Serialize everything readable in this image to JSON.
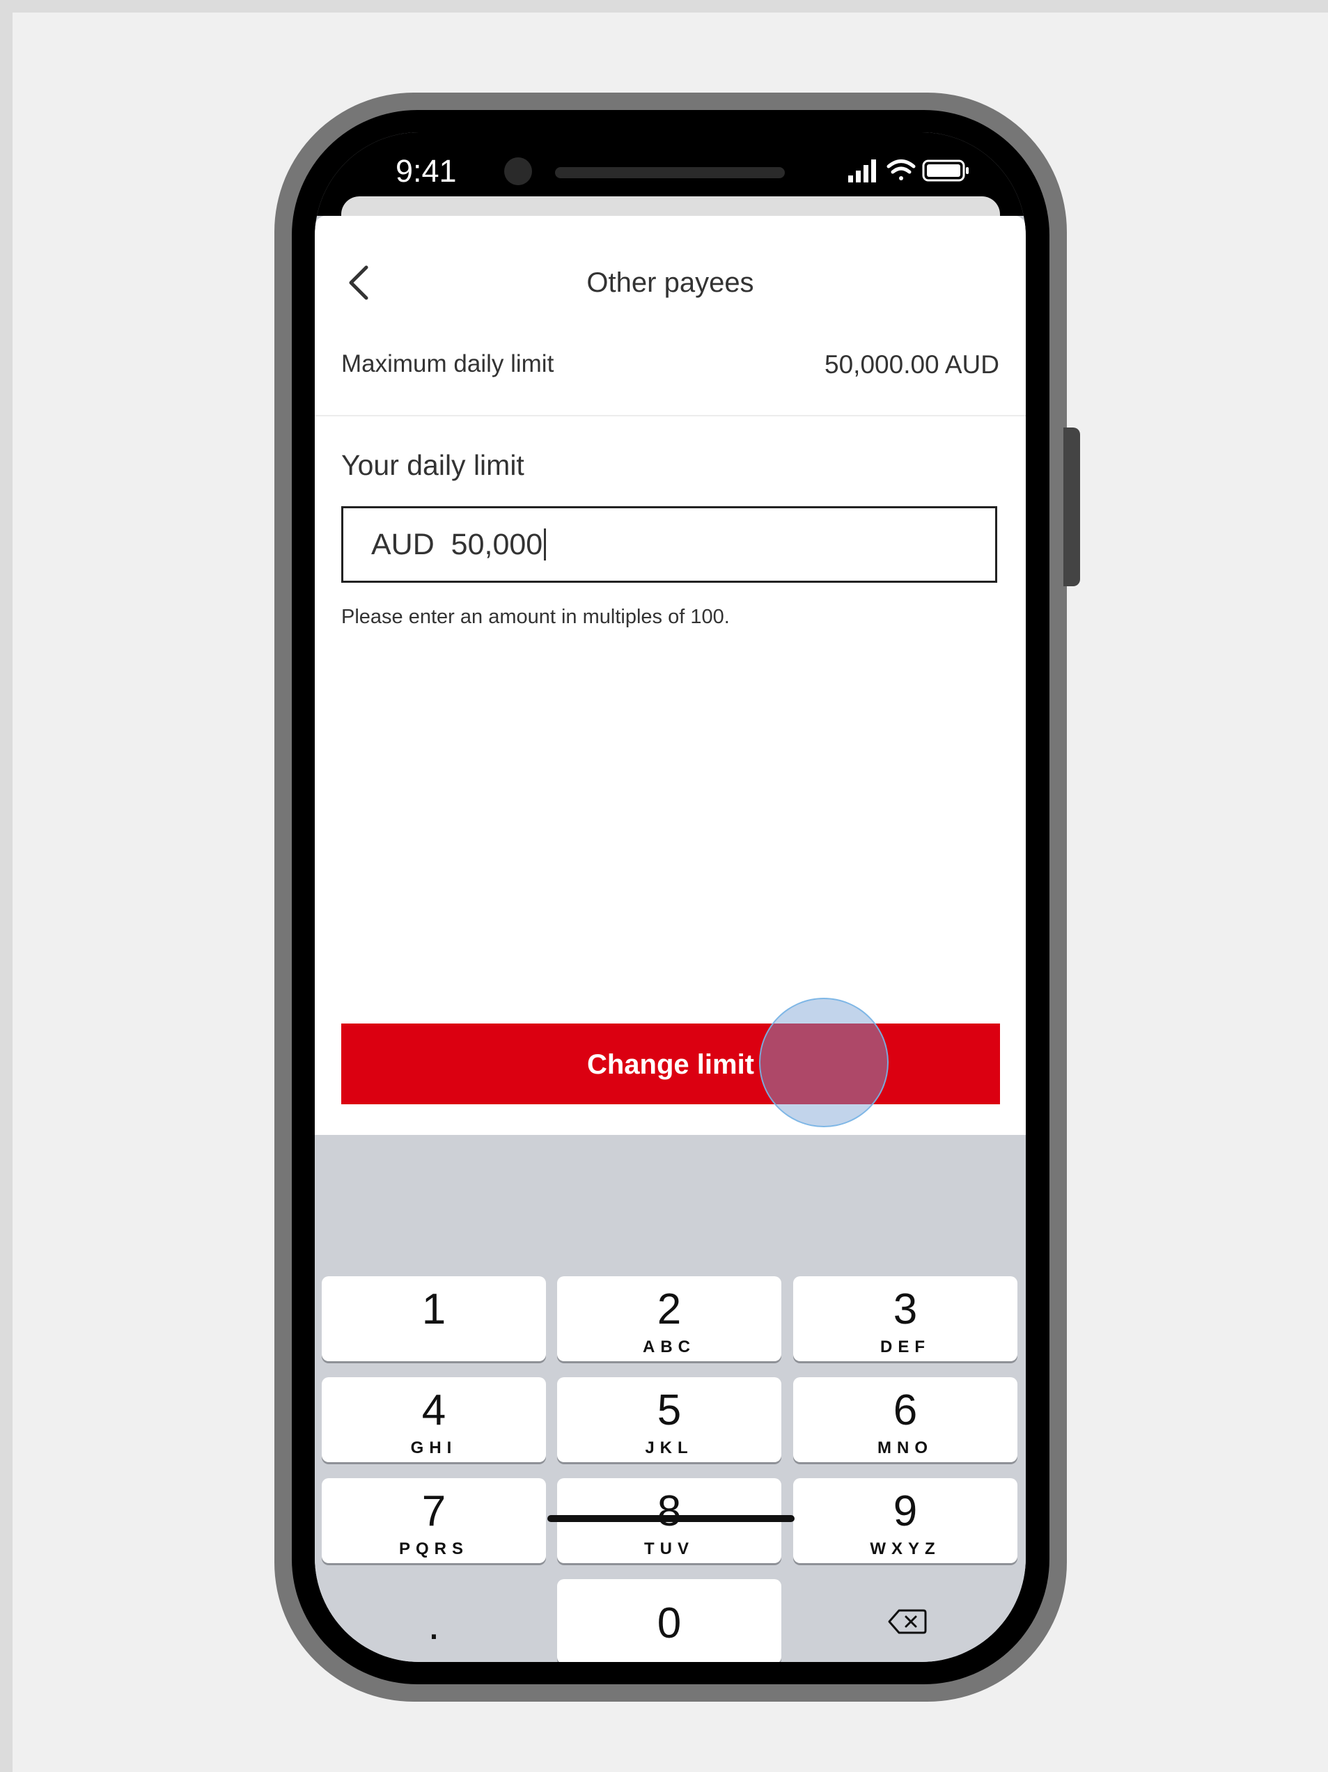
{
  "status_bar": {
    "time": "9:41"
  },
  "header": {
    "title": "Other payees",
    "back_icon": "chevron-left-icon"
  },
  "maximum_limit": {
    "label": "Maximum daily limit",
    "value": "50,000.00 AUD"
  },
  "daily_limit": {
    "label": "Your daily limit",
    "input_value": "AUD  50,000",
    "hint": "Please enter an amount in multiples of 100."
  },
  "change_button": {
    "label": "Change limit"
  },
  "keypad": {
    "keys": [
      {
        "number": "1",
        "letters": ""
      },
      {
        "number": "2",
        "letters": "ABC"
      },
      {
        "number": "3",
        "letters": "DEF"
      },
      {
        "number": "4",
        "letters": "GHI"
      },
      {
        "number": "5",
        "letters": "JKL"
      },
      {
        "number": "6",
        "letters": "MNO"
      },
      {
        "number": "7",
        "letters": "PQRS"
      },
      {
        "number": "8",
        "letters": "TUV"
      },
      {
        "number": "9",
        "letters": "WXYZ"
      },
      {
        "number": "0",
        "letters": ""
      }
    ],
    "decimal": ".",
    "delete_icon": "backspace-icon"
  },
  "colors": {
    "accent_red": "#db0011",
    "keyboard_bg": "#cdd0d6"
  }
}
